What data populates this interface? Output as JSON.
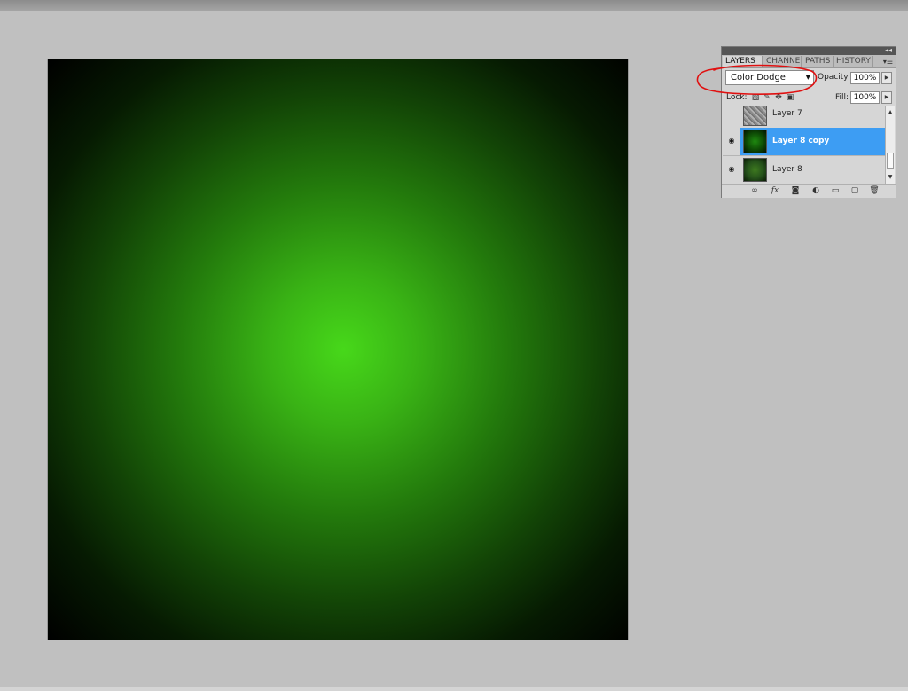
{
  "canvas": {
    "gradient_center_color": "#47d81a",
    "gradient_edge_color": "#000000",
    "background_color": "#c0c0c0"
  },
  "panel": {
    "tabs": [
      {
        "label": "LAYERS",
        "active": true
      },
      {
        "label": "CHANNE",
        "active": false
      },
      {
        "label": "PATHS",
        "active": false
      },
      {
        "label": "HISTORY",
        "active": false
      }
    ],
    "blend_mode": "Color Dodge",
    "opacity_label": "Opacity:",
    "opacity_value": "100%",
    "lock_label": "Lock:",
    "fill_label": "Fill:",
    "fill_value": "100%",
    "layers": [
      {
        "name": "Layer 7",
        "visible": false,
        "selected": false
      },
      {
        "name": "Layer 8 copy",
        "visible": true,
        "selected": true
      },
      {
        "name": "Layer 8",
        "visible": true,
        "selected": false
      }
    ],
    "selection_color": "#3d9df3",
    "icons": {
      "panel_collapse": "double-chevron-right-icon",
      "panel_menu": "panel-menu-icon",
      "blend_dropdown": "chevron-down-icon",
      "eye": "eye-icon",
      "bottom_tools": [
        "link-layers-icon",
        "fx-icon",
        "add-mask-icon",
        "adjustment-layer-icon",
        "new-group-icon",
        "new-layer-icon",
        "trash-icon"
      ]
    }
  },
  "annotation": {
    "shape": "hand-drawn red ellipse around blend mode",
    "color": "#e01010"
  }
}
